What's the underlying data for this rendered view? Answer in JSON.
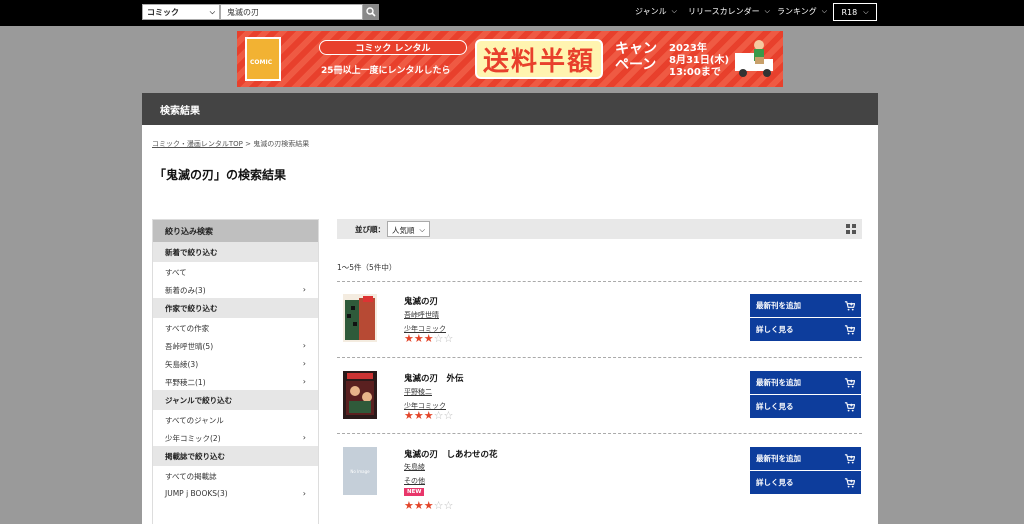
{
  "topbar": {
    "category_value": "コミック",
    "search_value": "鬼滅の刃",
    "nav": [
      {
        "label": "ジャンル"
      },
      {
        "label": "リリースカレンダー"
      },
      {
        "label": "ランキング"
      }
    ],
    "r18_label": "R18"
  },
  "banner": {
    "logo_text": "COMIC",
    "pill_text": "コミック レンタル",
    "sub_text": "25冊以上一度にレンタルしたら",
    "big_text": "送料半額",
    "camp_line1": "キャン",
    "camp_line2": "ペーン",
    "date_line1": "2023年",
    "date_line2": "8月31日(木)",
    "date_line3": "13:00まで"
  },
  "header": {
    "title": "検索結果"
  },
  "breadcrumb": {
    "link": "コミック・漫画レンタルTOP",
    "sep": " > ",
    "current": "鬼滅の刃検索結果"
  },
  "page_title": "「鬼滅の刃」の検索結果",
  "sidebar": {
    "title": "絞り込み検索",
    "sections": {
      "new": {
        "heading": "新着で絞り込む",
        "items": [
          "すべて",
          "新着のみ(3)"
        ]
      },
      "author": {
        "heading": "作家で絞り込む",
        "items": [
          "すべての作家",
          "吾峠呼世晴(5)",
          "矢島綾(3)",
          "平野稜二(1)"
        ]
      },
      "genre": {
        "heading": "ジャンルで絞り込む",
        "items": [
          "すべてのジャンル",
          "少年コミック(2)"
        ]
      },
      "magazine": {
        "heading": "掲載誌で絞り込む",
        "items": [
          "すべての掲載誌",
          "JUMP j BOOKS(3)"
        ]
      }
    }
  },
  "sort": {
    "label": "並び順：",
    "value": "人気順"
  },
  "count_text": "1〜5件（5件中）",
  "results": [
    {
      "title": "鬼滅の刃",
      "author": "吾峠呼世晴",
      "genre": "少年コミック",
      "rating": 3,
      "new": false
    },
    {
      "title": "鬼滅の刃　外伝",
      "author": "平野稜二",
      "genre": "少年コミック",
      "rating": 3,
      "new": false
    },
    {
      "title": "鬼滅の刃　しあわせの花",
      "author": "矢島綾",
      "genre": "その他",
      "rating": 3,
      "new": true,
      "badge": "NEW",
      "cover_text": "No Image"
    }
  ],
  "buttons": {
    "add_latest": "最新刊を追加",
    "details": "詳しく見る"
  },
  "colors": {
    "accent_blue": "#0d3d9c",
    "star": "#e3452a",
    "header": "#444444"
  }
}
